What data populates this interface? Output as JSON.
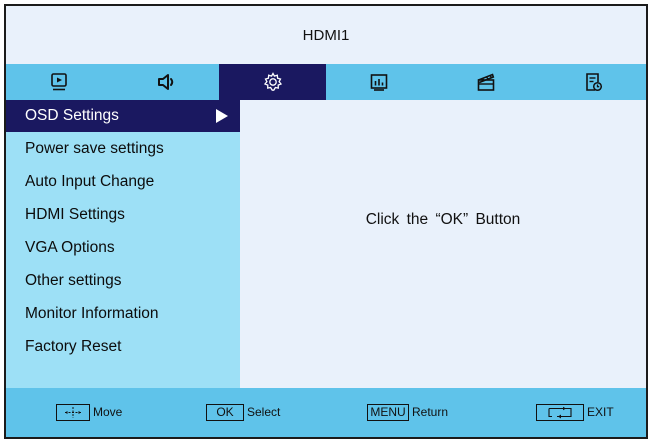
{
  "header": {
    "title": "HDMI1"
  },
  "tabs": [
    {
      "icon": "picture-play-icon",
      "active": false
    },
    {
      "icon": "speaker-icon",
      "active": false
    },
    {
      "icon": "gear-icon",
      "active": true
    },
    {
      "icon": "bar-chart-icon",
      "active": false
    },
    {
      "icon": "clapperboard-icon",
      "active": false
    },
    {
      "icon": "schedule-clock-icon",
      "active": false
    }
  ],
  "menu": {
    "items": [
      {
        "label": "OSD Settings",
        "selected": true
      },
      {
        "label": "Power save settings",
        "selected": false
      },
      {
        "label": "Auto Input Change",
        "selected": false
      },
      {
        "label": "HDMI Settings",
        "selected": false
      },
      {
        "label": "VGA Options",
        "selected": false
      },
      {
        "label": "Other settings",
        "selected": false
      },
      {
        "label": "Monitor Information",
        "selected": false
      },
      {
        "label": "Factory Reset",
        "selected": false
      }
    ]
  },
  "content": {
    "message": "Click  the  “OK”  Button"
  },
  "footer": {
    "move": {
      "key_icon": "dpad-icon",
      "label": "Move"
    },
    "select": {
      "key": "OK",
      "label": "Select"
    },
    "return": {
      "key": "MENU",
      "label": "Return"
    },
    "exit": {
      "key_icon": "return-arrows-icon",
      "label": "EXIT"
    }
  },
  "colors": {
    "background": "#e9f1fb",
    "tab_bar": "#5fc3ea",
    "menu_panel": "#9de0f6",
    "highlight": "#1a1860",
    "footer": "#5fc3ea"
  }
}
